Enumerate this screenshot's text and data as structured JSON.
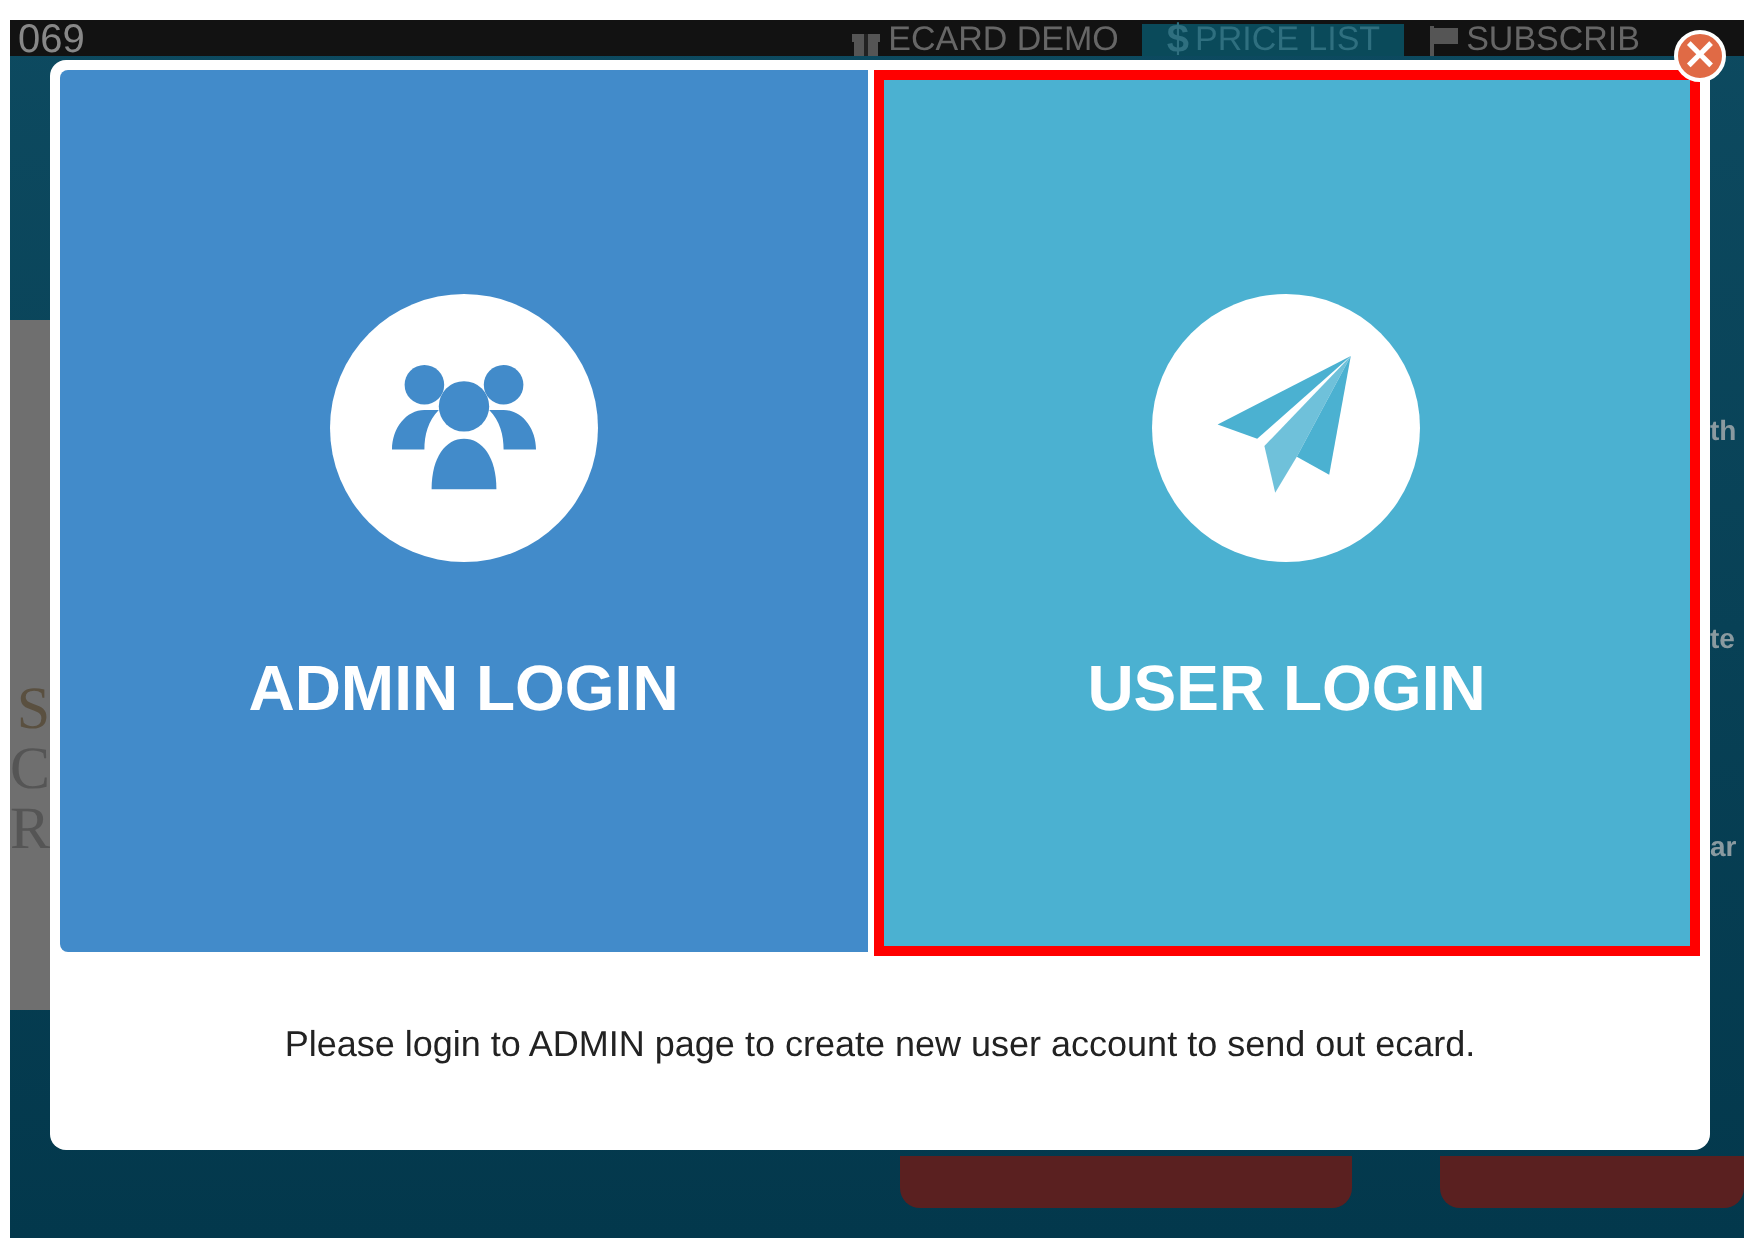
{
  "background": {
    "site_number": "069",
    "nav": [
      {
        "label": "ECARD DEMO",
        "kind": "gift",
        "selected": false
      },
      {
        "label": "PRICE LIST",
        "kind": "dollar",
        "symbol": "$",
        "selected": true
      },
      {
        "label": "SUBSCRIB",
        "kind": "flag",
        "selected": false
      }
    ],
    "left_fragments": [
      "S",
      "C",
      "R"
    ],
    "right_fragments": [
      "th",
      "te",
      "ar"
    ]
  },
  "modal": {
    "tiles": [
      {
        "label": "ADMIN LOGIN",
        "kind": "users",
        "color": "#428bca",
        "selected": false
      },
      {
        "label": "USER LOGIN",
        "kind": "plane",
        "color": "#4bb1d1",
        "selected": true
      }
    ],
    "message": "Please login to ADMIN page to create new user account to send out ecard.",
    "close": "×"
  }
}
